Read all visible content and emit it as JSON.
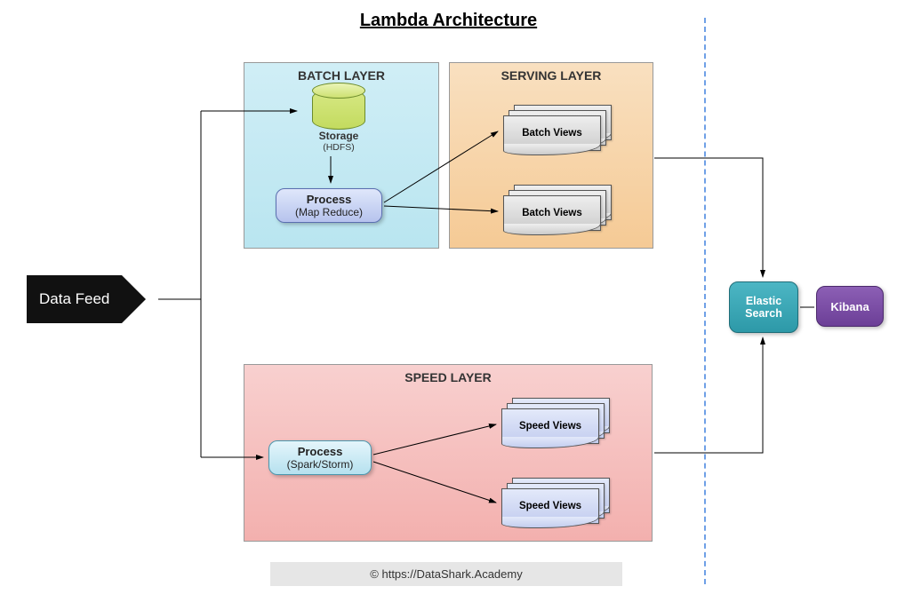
{
  "title": "Lambda Architecture",
  "data_feed": "Data Feed",
  "layers": {
    "batch": "BATCH LAYER",
    "serving": "SERVING LAYER",
    "speed": "SPEED LAYER"
  },
  "storage": {
    "label": "Storage",
    "sub": "(HDFS)"
  },
  "process_batch": {
    "label": "Process",
    "sub": "(Map Reduce)"
  },
  "process_speed": {
    "label": "Process",
    "sub": "(Spark/Storm)"
  },
  "views": {
    "batch": "Batch Views",
    "speed": "Speed Views"
  },
  "elastic": "Elastic Search",
  "kibana": "Kibana",
  "copyright": "© https://DataShark.Academy"
}
